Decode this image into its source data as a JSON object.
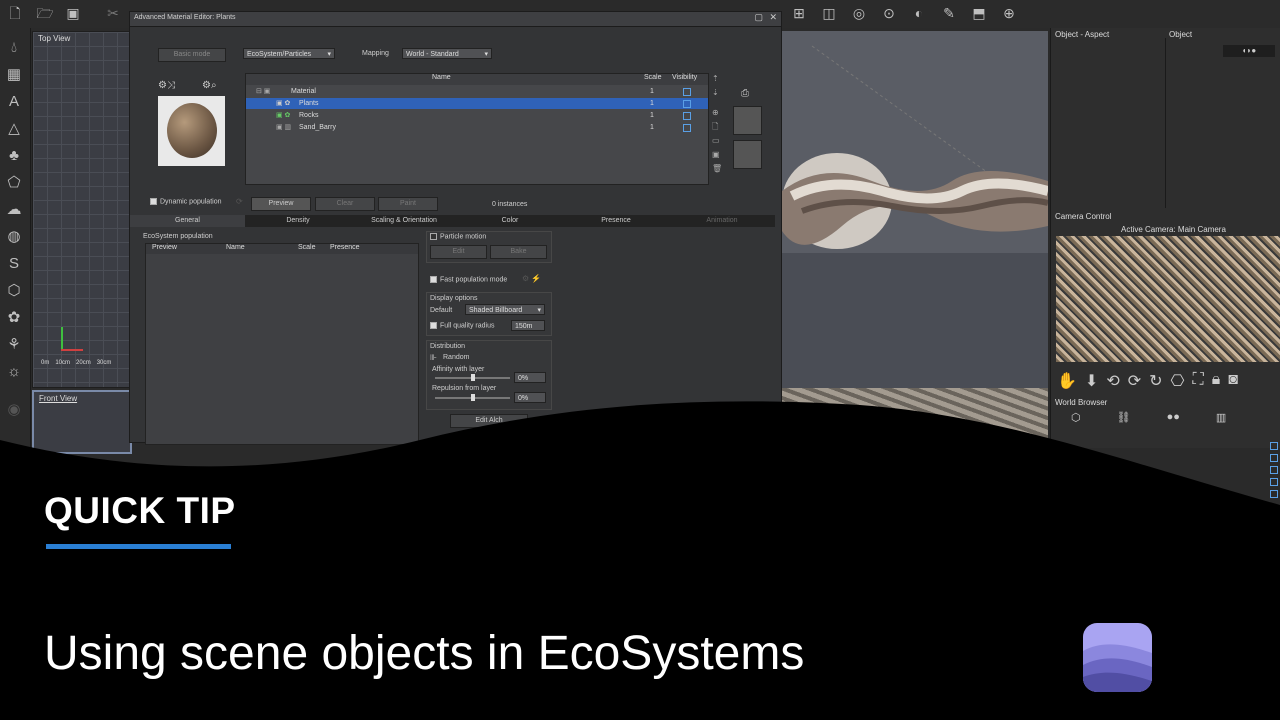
{
  "viewports": {
    "top_view_label": "Top View",
    "front_view_label": "Front View",
    "scale_labels": [
      "0m",
      "10cm",
      "20cm",
      "30cm"
    ]
  },
  "dialog": {
    "title": "Advanced Material Editor: Plants",
    "basic_mode_label": "Basic mode",
    "material_type": "EcoSystem/Particles",
    "mapping_label": "Mapping",
    "mapping_value": "World - Standard",
    "tree": {
      "headers": {
        "name": "Name",
        "scale": "Scale",
        "visibility": "Visibility"
      },
      "rows": [
        {
          "name": "Material",
          "scale": "1"
        },
        {
          "name": "Plants",
          "scale": "1"
        },
        {
          "name": "Rocks",
          "scale": "1"
        },
        {
          "name": "Sand_Barry",
          "scale": "1"
        }
      ]
    },
    "dynamic_population_label": "Dynamic population",
    "preview_button": "Preview",
    "clear_button": "Clear",
    "paint_button": "Paint",
    "instances_label": "0 instances",
    "tabs": [
      "General",
      "Density",
      "Scaling & Orientation",
      "Color",
      "Presence",
      "Animation"
    ],
    "ecosystem_population_label": "EcoSystem population",
    "list_headers": {
      "preview": "Preview",
      "name": "Name",
      "scale": "Scale",
      "presence": "Presence"
    },
    "particle_motion_label": "Particle motion",
    "edit_button": "Edit",
    "bake_button": "Bake",
    "fast_population_label": "Fast population mode",
    "display_options_label": "Display options",
    "default_label": "Default",
    "display_mode": "Shaded Billboard",
    "full_quality_label": "Full quality radius",
    "full_quality_value": "150m",
    "distribution_label": "Distribution",
    "random_label": "Random",
    "affinity_label": "Affinity with layer",
    "affinity_value": "0%",
    "repulsion_label": "Repulsion from layer",
    "repulsion_value": "0%",
    "edit_alch_button": "Edit Alch"
  },
  "right_panel": {
    "object_aspect_label": "Object - Aspect",
    "object_label": "Object",
    "camera_control_label": "Camera Control",
    "active_camera_label": "Active Camera: Main Camera",
    "world_browser_label": "World Browser"
  },
  "overlay": {
    "tag": "QUICK TIP",
    "title": "Using scene objects in EcoSystems",
    "accent_color": "#2a7fd4",
    "logo_color": "#8f8fe6"
  }
}
